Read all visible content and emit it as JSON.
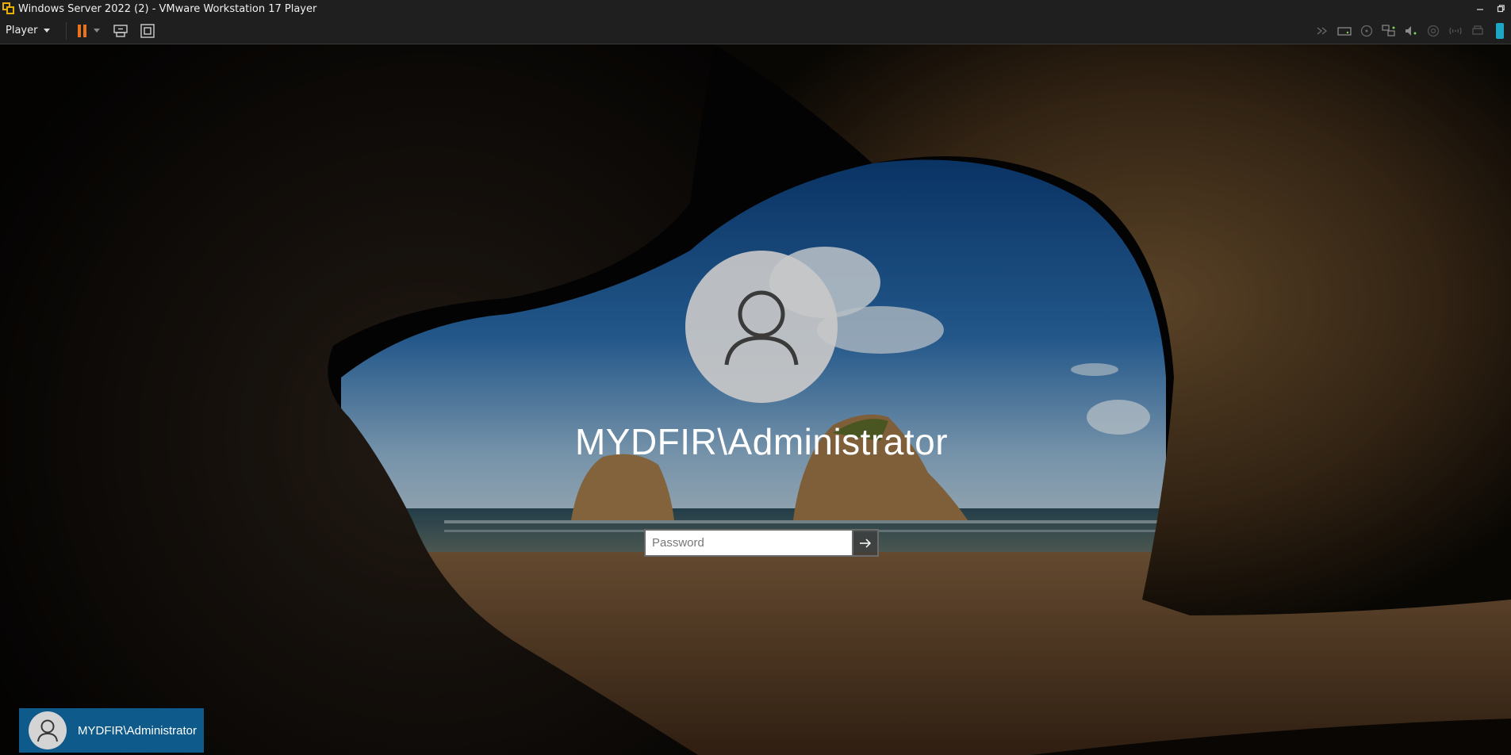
{
  "window": {
    "title": "Windows Server 2022 (2) - VMware Workstation 17 Player",
    "controls": [
      "minimize",
      "restore"
    ]
  },
  "toolbar": {
    "player_menu_label": "Player",
    "left_icons": [
      "pause-icon",
      "send-ctrl-alt-del-icon",
      "fullscreen-icon"
    ],
    "right_icons": [
      "devices-more-icon",
      "hard-disk-icon",
      "cd-dvd-icon",
      "network-adapter-icon",
      "sound-card-icon",
      "usb-icon",
      "bluetooth-icon",
      "printer-icon",
      "display-icon"
    ]
  },
  "login": {
    "user_display_name": "MYDFIR\\Administrator",
    "password_placeholder": "Password",
    "password_value": "",
    "submit_icon": "arrow-right-icon"
  },
  "user_switcher": {
    "users": [
      {
        "name": "MYDFIR\\Administrator",
        "selected": true
      }
    ]
  },
  "colors": {
    "chrome_bg": "#1f1f1f",
    "pause_accent": "#e8731a",
    "tile_selected": "#0e5a8a"
  }
}
